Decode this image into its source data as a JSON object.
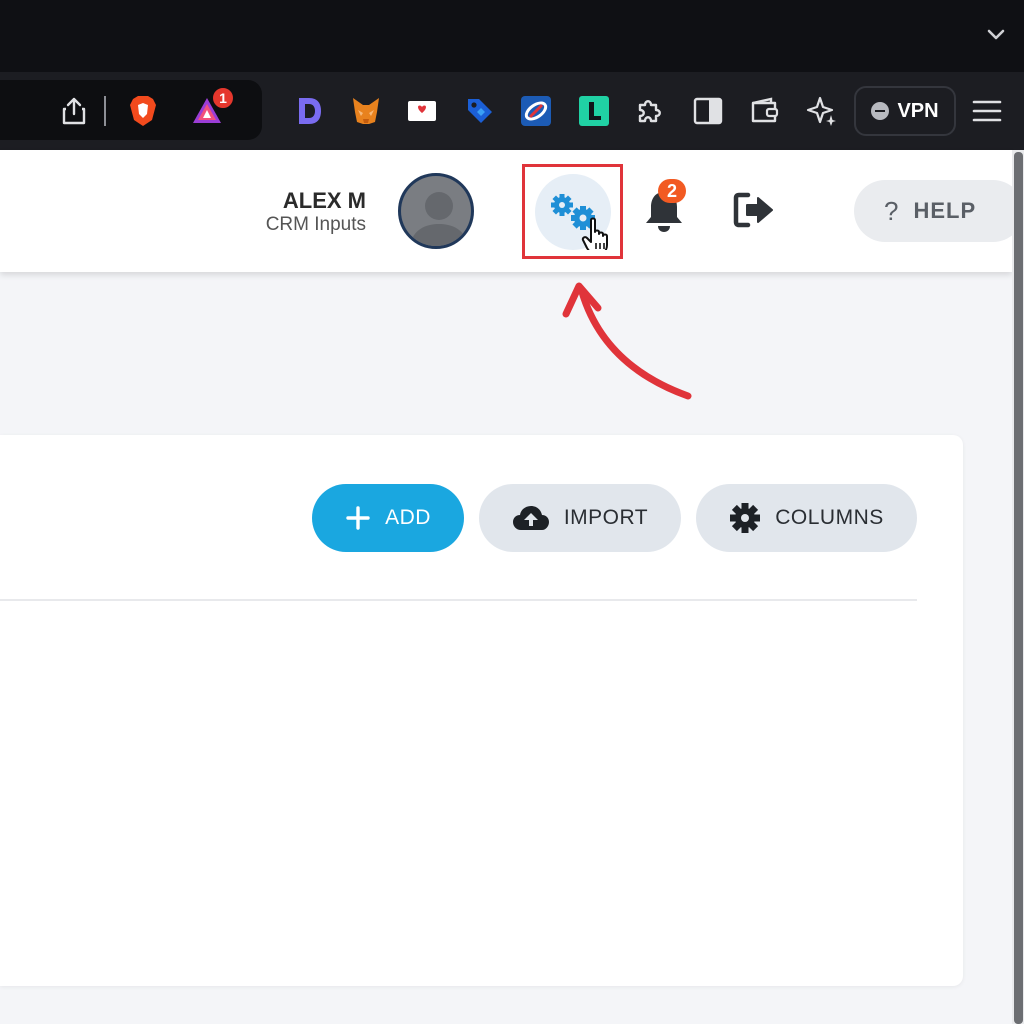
{
  "browser": {
    "extensions": [
      "share-icon",
      "brave-shields-icon",
      "brave-rewards-icon",
      "d-extension-icon",
      "metamask-icon",
      "mail-extension-icon",
      "tag-extension-icon",
      "link-extension-icon",
      "l-extension-icon",
      "puzzle-icon",
      "sidebar-icon",
      "wallet-icon",
      "leo-ai-icon"
    ],
    "rewards_badge": "1",
    "vpn_label": "VPN"
  },
  "header": {
    "user_name": "ALEX M",
    "user_role": "CRM Inputs",
    "notification_count": "2",
    "help_label": "HELP"
  },
  "toolbar": {
    "add_label": "ADD",
    "import_label": "IMPORT",
    "columns_label": "COLUMNS"
  },
  "colors": {
    "accent": "#1aa7e0",
    "highlight": "#e0343a",
    "badge": "#f25a22"
  }
}
